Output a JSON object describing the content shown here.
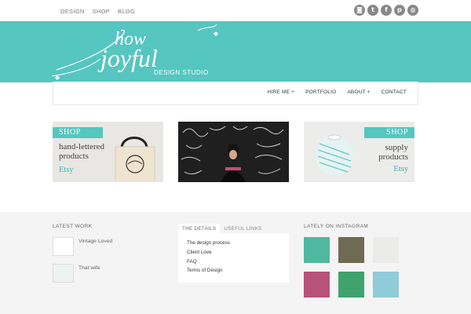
{
  "top_nav": [
    "DESIGN",
    "SHOP",
    "BLOG"
  ],
  "social_icons": [
    "instagram-icon",
    "twitter-icon",
    "facebook-icon",
    "pinterest-icon",
    "dribbble-icon"
  ],
  "brand": {
    "line1": "how",
    "line2": "joyful",
    "subtitle": "DESIGN STUDIO",
    "accent": "#56c6c0"
  },
  "main_nav": [
    "HIRE ME +",
    "PORTFOLIO",
    "ABOUT +",
    "CONTACT"
  ],
  "promos": [
    {
      "tag": "SHOP",
      "line1": "hand-lettered",
      "line2": "products",
      "link": "Etsy"
    },
    {
      "tag": "",
      "line1": "",
      "line2": "",
      "link": ""
    },
    {
      "tag": "SHOP",
      "line1": "supply",
      "line2": "products",
      "link": "Etsy"
    }
  ],
  "footer": {
    "latest_work_title": "LATEST WORK",
    "latest_work": [
      "Vintage Loved",
      "That wife"
    ],
    "tabs": [
      "THE DETAILS",
      "USEFUL LINKS"
    ],
    "details_links": [
      "The design process",
      "Client Love",
      "FAQ",
      "Terms of Design"
    ],
    "instagram_title": "LATELY ON INSTAGRAM"
  }
}
